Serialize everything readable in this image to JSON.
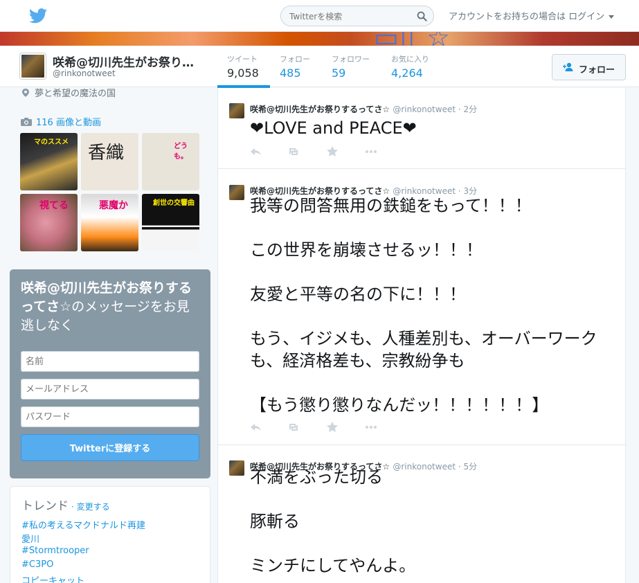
{
  "nav": {
    "search_placeholder": "Twitterを検索",
    "login_text": "アカウントをお持ちの場合は ログイン"
  },
  "colors": {
    "accent": "#1b95e0",
    "signup_bg": "#8899a6",
    "button": "#55acee"
  },
  "profile": {
    "name": "咲希@切川先生がお祭りするってさ☆",
    "handle": "@rinkonotweet",
    "location": "夢と希望の魔法の国",
    "media_label": "116 画像と動画",
    "follow_button": "フォロー",
    "stats": [
      {
        "label": "ツイート",
        "value": "9,058"
      },
      {
        "label": "フォロー",
        "value": "485"
      },
      {
        "label": "フォロワー",
        "value": "59"
      },
      {
        "label": "お気に入り",
        "value": "4,264"
      }
    ]
  },
  "thumbs": [
    {
      "caption": "マのススメ"
    },
    {
      "caption": "香織"
    },
    {
      "caption": "どうも。"
    },
    {
      "caption": "視てる"
    },
    {
      "caption": "悪魔か"
    },
    {
      "caption": "創世の交響曲"
    }
  ],
  "signup": {
    "title_bold": "咲希@切川先生がお祭りするってさ☆",
    "title_rest": "のメッセージをお見逃しなく",
    "name_placeholder": "名前",
    "email_placeholder": "メールアドレス",
    "password_placeholder": "パスワード",
    "button": "Twitterに登録する"
  },
  "trends": {
    "title": "トレンド",
    "change": "· 変更する",
    "items": [
      "#私の考えるマクドナルド再建",
      "愛川",
      "#Stormtrooper",
      "#C3PO",
      "コピーキャット"
    ]
  },
  "tweets": [
    {
      "name": "咲希@切川先生がお祭りするってさ☆",
      "meta": "@rinkonotweet · 2分",
      "text": "❤LOVE and PEACE❤"
    },
    {
      "name": "咲希@切川先生がお祭りするってさ☆",
      "meta": "@rinkonotweet · 3分",
      "text": "我等の問答無用の鉄鎚をもって！！！\n\nこの世界を崩壊させるッ！！！\n\n友愛と平等の名の下に！！！\n\nもう、イジメも、人種差別も、オーバーワークも、経済格差も、宗教紛争も\n\n【もう懲り懲りなんだッ！！！！！！】"
    },
    {
      "name": "咲希@切川先生がお祭りするってさ☆",
      "meta": "@rinkonotweet · 5分",
      "text": "不満をぶった切る\n\n豚斬る\n\nミンチにしてやんよ。"
    }
  ]
}
